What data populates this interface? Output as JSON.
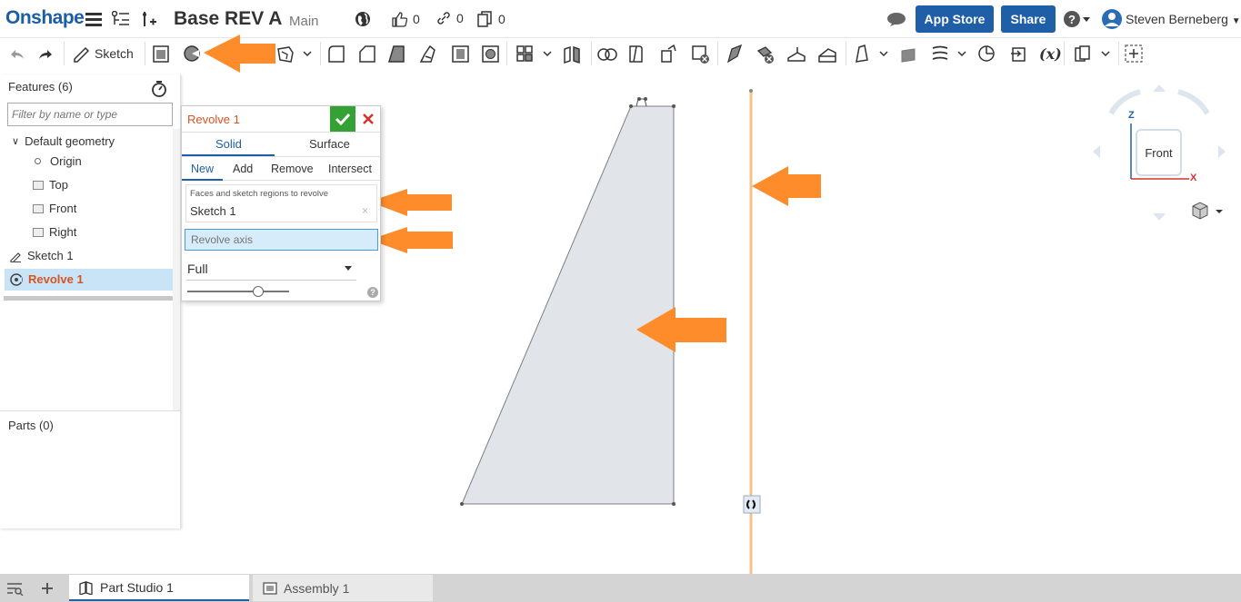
{
  "app": {
    "logo": "Onshape",
    "doc_title": "Base REV A",
    "branch": "Main",
    "likes": "0",
    "links": "0",
    "copies": "0",
    "app_store": "App Store",
    "share": "Share",
    "user": "Steven Berneberg"
  },
  "toolbar": {
    "sketch_label": "Sketch"
  },
  "features": {
    "title": "Features (6)",
    "filter_placeholder": "Filter by name or type",
    "default_geometry": "Default geometry",
    "origin": "Origin",
    "top": "Top",
    "front": "Front",
    "right": "Right",
    "sketch1": "Sketch 1",
    "revolve1": "Revolve 1",
    "parts": "Parts (0)"
  },
  "dialog": {
    "title": "Revolve 1",
    "tab_solid": "Solid",
    "tab_surface": "Surface",
    "op_new": "New",
    "op_add": "Add",
    "op_remove": "Remove",
    "op_intersect": "Intersect",
    "faces_label": "Faces and sketch regions to revolve",
    "faces_value": "Sketch 1",
    "axis_placeholder": "Revolve axis",
    "type_value": "Full",
    "clear_glyph": "×",
    "help_glyph": "?"
  },
  "viewcube": {
    "face": "Front",
    "z": "Z",
    "x": "X"
  },
  "tabs": {
    "part_studio": "Part Studio 1",
    "assembly": "Assembly 1"
  },
  "colors": {
    "brand": "#1f5fa8",
    "accent_orange": "#ff8c2b",
    "confirm_green": "#33a133",
    "cancel_red": "#d9302b",
    "axis_line": "#f5c38a",
    "sketch_fill": "#e1e4e8"
  }
}
